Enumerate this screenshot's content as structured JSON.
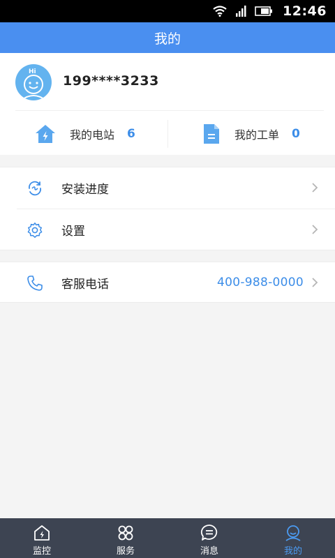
{
  "status_bar": {
    "time": "12:46"
  },
  "header": {
    "title": "我的"
  },
  "profile": {
    "avatar_text": "Hi",
    "phone": "199****3233",
    "stats": [
      {
        "label": "我的电站",
        "count": "6"
      },
      {
        "label": "我的工单",
        "count": "0"
      }
    ]
  },
  "menu": {
    "items": [
      {
        "label": "安装进度"
      },
      {
        "label": "设置"
      }
    ]
  },
  "service": {
    "label": "客服电话",
    "value": "400-988-0000"
  },
  "tabbar": {
    "tabs": [
      {
        "label": "监控"
      },
      {
        "label": "服务"
      },
      {
        "label": "消息"
      },
      {
        "label": "我的"
      }
    ],
    "active_index": 3
  },
  "colors": {
    "header": "#4a8ff0",
    "accent": "#3c8de8",
    "tabbar": "#3d4452",
    "tab_active": "#4b9bf2"
  }
}
